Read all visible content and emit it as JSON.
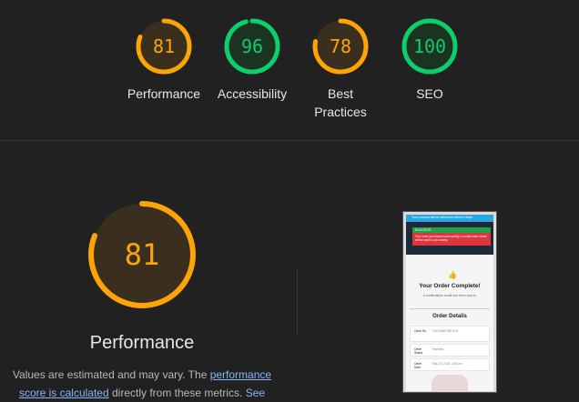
{
  "summary": {
    "gauges": [
      {
        "value": "81",
        "score": 0.81,
        "label": "Performance",
        "status": "average"
      },
      {
        "value": "96",
        "score": 0.96,
        "label": "Accessibility",
        "status": "pass"
      },
      {
        "value": "78",
        "score": 0.78,
        "label": "Best\nPractices",
        "status": "average"
      },
      {
        "value": "100",
        "score": 1.0,
        "label": "SEO",
        "status": "pass"
      }
    ]
  },
  "colors": {
    "average": "#ffa400",
    "average_fill": "#3a2f1e",
    "pass": "#0cce6b",
    "pass_fill": "#1c3322",
    "background": "#212121"
  },
  "category": {
    "value": "81",
    "score": 0.81,
    "title": "Performance",
    "desc_prefix": "Values are estimated and may vary. The ",
    "desc_link": "performance score is calculated",
    "desc_middle": " directly from these metrics. ",
    "desc_see": "See"
  },
  "screenshot": {
    "banner": "Your product will be delivered within 4 days",
    "alert_head": "SUCCESS",
    "alert_body": "Your order processed successfully, a confirmation email will be sent to you shortly",
    "icon": "thumbs-up-icon",
    "title": "Your Order Complete!",
    "subtitle": "A confirmation email has been sent to",
    "details_title": "Order Details",
    "rows": [
      {
        "key": "Order No",
        "value": "1812345678901234"
      },
      {
        "key": "Order Status",
        "value": "received"
      },
      {
        "key": "Order Date",
        "value": "May 20, 2024, 1:05 pm"
      }
    ]
  }
}
